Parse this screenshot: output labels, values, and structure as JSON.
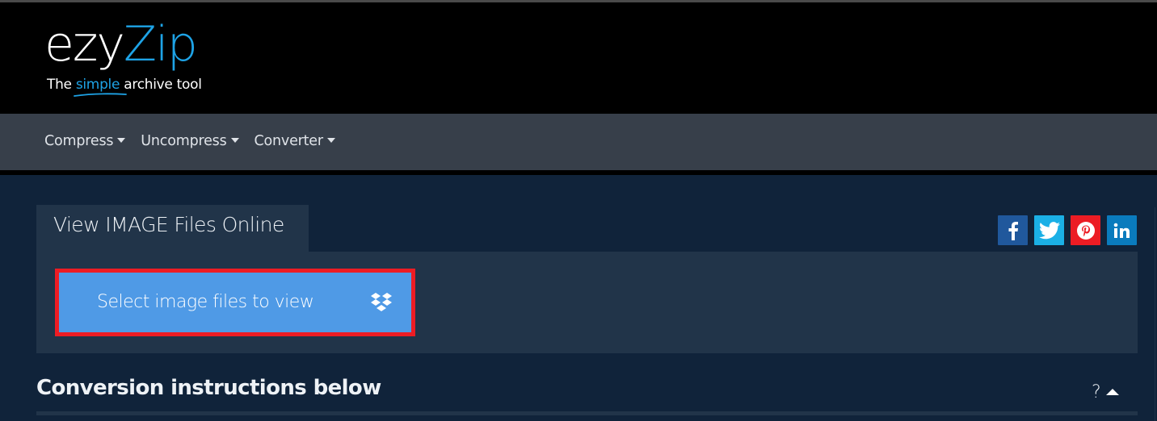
{
  "brand": {
    "logo_part1": "ezy",
    "logo_part2": "Zip",
    "tagline_pre": "The ",
    "tagline_highlight": "simple",
    "tagline_post": " archive tool",
    "colors": {
      "accent": "#1ea3e6",
      "header_bg": "#000000",
      "navbar_bg": "#373f4a",
      "page_bg": "#10233a",
      "panel_bg": "#213449"
    }
  },
  "nav": {
    "items": [
      {
        "label": "Compress",
        "icon": "caret-down-icon"
      },
      {
        "label": "Uncompress",
        "icon": "caret-down-icon"
      },
      {
        "label": "Converter",
        "icon": "caret-down-icon"
      }
    ]
  },
  "tool": {
    "tab_title": "View IMAGE Files Online",
    "select_button_label": "Select image files to view",
    "select_button_icon": "dropbox-icon",
    "select_button_color": "#4f9ae6",
    "highlight_border_color": "#ed1c24"
  },
  "social": [
    {
      "name": "facebook",
      "icon": "facebook-icon",
      "color": "#20589c"
    },
    {
      "name": "twitter",
      "icon": "twitter-icon",
      "color": "#1bb0e6"
    },
    {
      "name": "pinterest",
      "icon": "pinterest-icon",
      "color": "#ec1c24"
    },
    {
      "name": "linkedin",
      "icon": "linkedin-icon",
      "color": "#0a7bbd"
    }
  ],
  "instructions": {
    "title": "Conversion instructions below",
    "help_label": "?",
    "toggle_icon": "caret-up-icon"
  }
}
